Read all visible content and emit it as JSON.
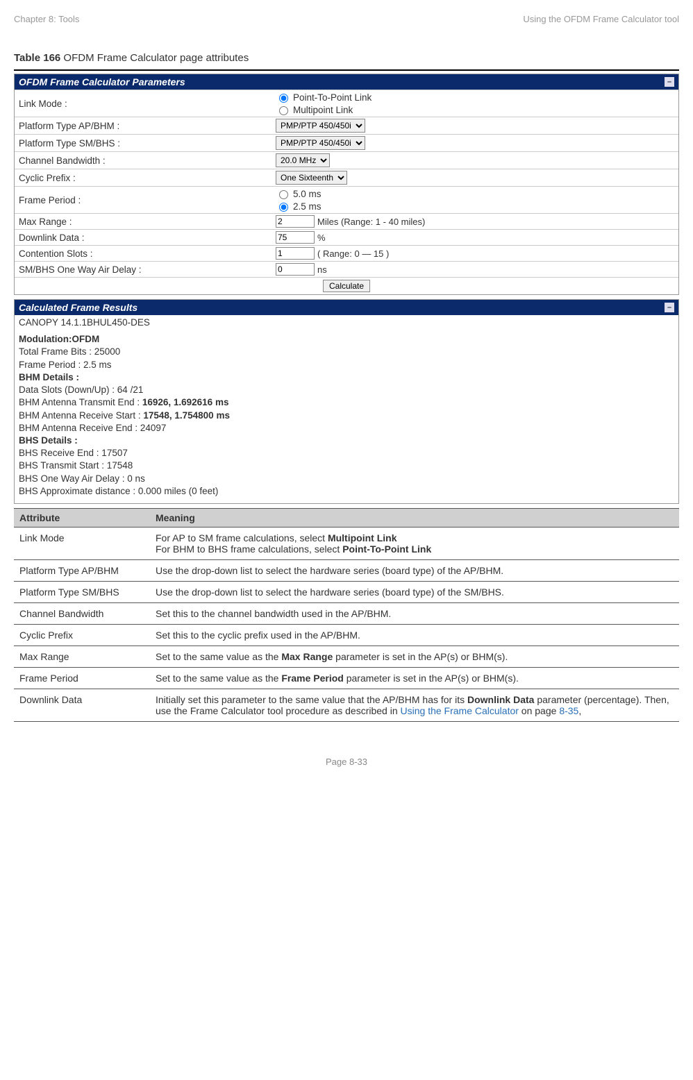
{
  "header": {
    "left": "Chapter 8:  Tools",
    "right": "Using the OFDM Frame Calculator tool"
  },
  "caption": {
    "label": "Table 166",
    "text": " OFDM Frame Calculator page attributes"
  },
  "panel1": {
    "title": "OFDM Frame Calculator Parameters",
    "rows": {
      "linkMode": {
        "label": "Link Mode :",
        "opt1": "Point-To-Point Link",
        "opt2": "Multipoint Link"
      },
      "platAP": {
        "label": "Platform Type AP/BHM :",
        "value": "PMP/PTP 450/450i"
      },
      "platSM": {
        "label": "Platform Type SM/BHS :",
        "value": "PMP/PTP 450/450i"
      },
      "chanBW": {
        "label": "Channel Bandwidth :",
        "value": "20.0 MHz"
      },
      "cyclic": {
        "label": "Cyclic Prefix :",
        "value": "One Sixteenth"
      },
      "framePeriod": {
        "label": "Frame Period :",
        "opt1": "5.0 ms",
        "opt2": "2.5 ms"
      },
      "maxRange": {
        "label": "Max Range :",
        "value": "2",
        "suffix": "Miles (Range: 1 - 40 miles)"
      },
      "downlink": {
        "label": "Downlink Data :",
        "value": "75",
        "suffix": "%"
      },
      "contention": {
        "label": "Contention Slots :",
        "value": "1",
        "suffix": "( Range: 0 — 15 )"
      },
      "airDelay": {
        "label": "SM/BHS One Way Air Delay :",
        "value": "0",
        "suffix": "ns"
      }
    },
    "button": "Calculate"
  },
  "panel2": {
    "title": "Calculated Frame Results",
    "lines": {
      "l0": "CANOPY 14.1.1BHUL450-DES",
      "l1": "Modulation:OFDM",
      "l2": "Total Frame Bits : 25000",
      "l3": "Frame Period : 2.5 ms",
      "l4": "BHM Details :",
      "l5": "Data Slots (Down/Up) : 64 /21",
      "l6a": "BHM Antenna Transmit End : ",
      "l6b": "16926, 1.692616 ms",
      "l7a": "BHM Antenna Receive Start : ",
      "l7b": "17548, 1.754800 ms",
      "l8": "BHM Antenna Receive End : 24097",
      "l9": "BHS Details :",
      "l10": "BHS Receive End : 17507",
      "l11": "BHS Transmit Start : 17548",
      "l12": "BHS One Way Air Delay : 0 ns",
      "l13": "BHS Approximate distance : 0.000 miles (0 feet)"
    }
  },
  "attrTable": {
    "hAttr": "Attribute",
    "hMean": "Meaning",
    "rows": {
      "r1a": "Link Mode",
      "r1b1": "For AP to SM frame calculations, select ",
      "r1b1b": "Multipoint Link",
      "r1b2": "For BHM to BHS frame calculations, select ",
      "r1b2b": "Point-To-Point Link",
      "r2a": "Platform Type AP/BHM",
      "r2b": "Use the drop-down list to select the hardware series (board type) of the AP/BHM.",
      "r3a": "Platform Type SM/BHS",
      "r3b": "Use the drop-down list to select the hardware series (board type) of the SM/BHS.",
      "r4a": "Channel Bandwidth",
      "r4b": "Set this to the channel bandwidth used in the AP/BHM.",
      "r5a": "Cyclic Prefix",
      "r5b": "Set this to the cyclic prefix used in the AP/BHM.",
      "r6a": "Max Range",
      "r6b1": "Set to the same value as the ",
      "r6bb": "Max Range",
      "r6b2": " parameter is set in the AP(s) or BHM(s).",
      "r7a": "Frame Period",
      "r7b1": "Set to the same value as the ",
      "r7bb": "Frame Period",
      "r7b2": " parameter is set in the AP(s) or BHM(s).",
      "r8a": "Downlink Data",
      "r8b1": "Initially set this parameter to the same value that the AP/BHM has for its ",
      "r8bb": "Downlink Data",
      "r8b2": " parameter (percentage). Then, use the Frame Calculator tool procedure as described in ",
      "r8link1": "Using the Frame Calculator",
      "r8b3": " on page ",
      "r8link2": "8-35",
      "r8b4": ","
    }
  },
  "footer": "Page 8-33"
}
